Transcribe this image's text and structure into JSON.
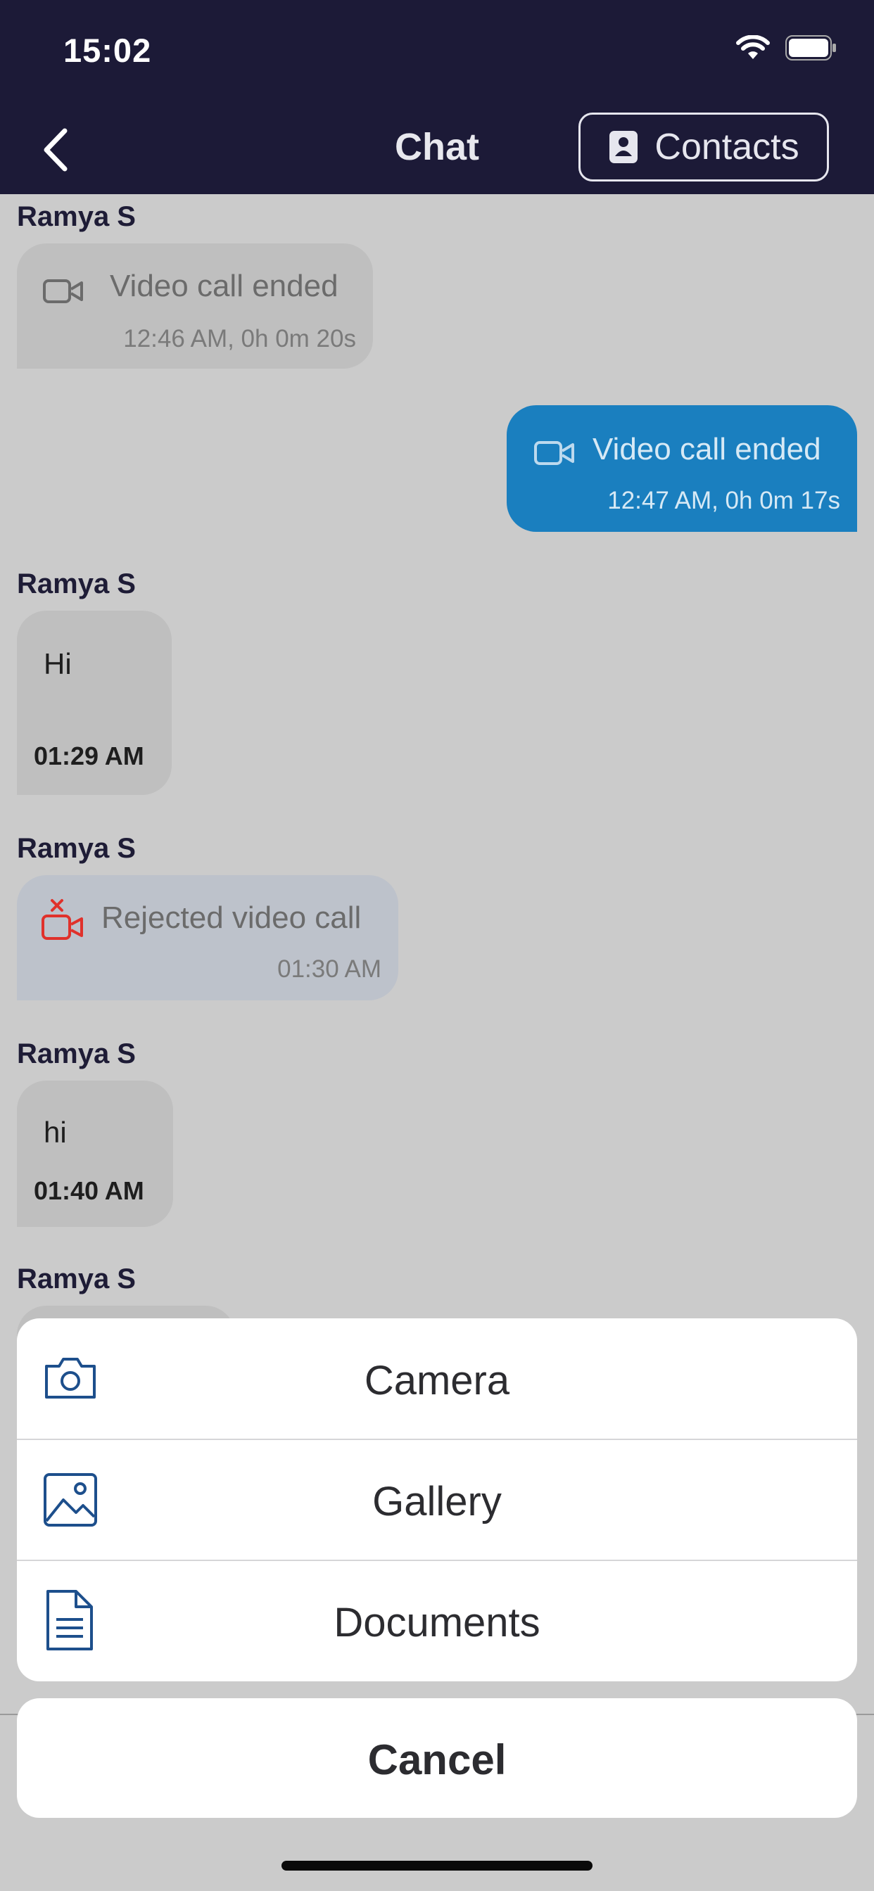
{
  "status_bar": {
    "time": "15:02"
  },
  "nav": {
    "title": "Chat",
    "contacts_label": "Contacts"
  },
  "messages": [
    {
      "sender": "Ramya S",
      "type": "call",
      "text": "Video call ended",
      "time": "12:46 AM, 0h 0m 20s"
    },
    {
      "type": "call_out",
      "text": "Video call ended",
      "time": "12:47 AM, 0h 0m 17s"
    },
    {
      "sender": "Ramya S",
      "type": "text",
      "text": "Hi",
      "time": "01:29 AM"
    },
    {
      "sender": "Ramya S",
      "type": "rejected_call",
      "text": "Rejected video call",
      "time": "01:30 AM"
    },
    {
      "sender": "Ramya S",
      "type": "text",
      "text": "hi",
      "time": "01:40 AM"
    },
    {
      "sender": "Ramya S"
    }
  ],
  "sheet": {
    "options": [
      {
        "label": "Camera",
        "icon": "camera-icon"
      },
      {
        "label": "Gallery",
        "icon": "image-icon"
      },
      {
        "label": "Documents",
        "icon": "document-icon"
      }
    ],
    "cancel_label": "Cancel"
  },
  "colors": {
    "header_bg": "#1c1a37",
    "outgoing_bubble": "#1a7fbf",
    "icon_blue": "#1d4f8c",
    "reject_red": "#e0312b"
  }
}
